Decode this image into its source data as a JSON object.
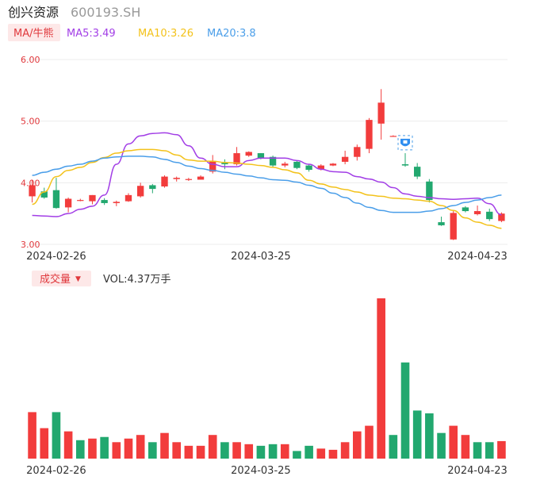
{
  "header": {
    "name": "创兴资源",
    "code": "600193.SH"
  },
  "indicator_button": {
    "label": "MA/牛熊",
    "color": "#e0383c",
    "bg": "#fde8e8"
  },
  "ma_legend": [
    {
      "label": "MA5:3.49",
      "color": "#a23ee6"
    },
    {
      "label": "MA10:3.26",
      "color": "#f3c21b"
    },
    {
      "label": "MA20:3.8",
      "color": "#4a9ee9"
    }
  ],
  "volume_button": {
    "label": "成交量",
    "arrow": "▼",
    "color": "#e0383c",
    "bg": "#fde8e8"
  },
  "volume_value": {
    "label": "VOL:4.37万手"
  },
  "colors": {
    "up": "#f23c3c",
    "down": "#22a86f",
    "grid": "#ececec",
    "axis_label": "#e0383c",
    "date_label": "#333333"
  },
  "chart_data": [
    {
      "type": "candlestick",
      "title": "",
      "ylim": [
        3.0,
        6.0
      ],
      "y_ticks": [
        "6.00",
        "5.00",
        "4.00",
        "3.00"
      ],
      "y_tick_values": [
        6.0,
        5.0,
        4.0,
        3.0
      ],
      "x_tick_labels": [
        {
          "label": "2024-02-26",
          "index": 2
        },
        {
          "label": "2024-03-25",
          "index": 19
        },
        {
          "label": "2024-04-23",
          "index": 37
        }
      ],
      "candles": [
        {
          "o": 3.78,
          "h": 4.05,
          "l": 3.68,
          "c": 3.96
        },
        {
          "o": 3.86,
          "h": 3.92,
          "l": 3.74,
          "c": 3.76
        },
        {
          "o": 3.88,
          "h": 4.08,
          "l": 3.58,
          "c": 3.59
        },
        {
          "o": 3.6,
          "h": 3.76,
          "l": 3.52,
          "c": 3.74
        },
        {
          "o": 3.71,
          "h": 3.74,
          "l": 3.7,
          "c": 3.72
        },
        {
          "o": 3.7,
          "h": 3.8,
          "l": 3.65,
          "c": 3.8
        },
        {
          "o": 3.72,
          "h": 3.75,
          "l": 3.64,
          "c": 3.67
        },
        {
          "o": 3.67,
          "h": 3.71,
          "l": 3.62,
          "c": 3.69
        },
        {
          "o": 3.7,
          "h": 3.83,
          "l": 3.69,
          "c": 3.8
        },
        {
          "o": 3.78,
          "h": 4.0,
          "l": 3.76,
          "c": 3.95
        },
        {
          "o": 3.96,
          "h": 3.98,
          "l": 3.83,
          "c": 3.9
        },
        {
          "o": 3.94,
          "h": 4.12,
          "l": 3.92,
          "c": 4.1
        },
        {
          "o": 4.06,
          "h": 4.1,
          "l": 4.02,
          "c": 4.08
        },
        {
          "o": 4.05,
          "h": 4.08,
          "l": 4.03,
          "c": 4.06
        },
        {
          "o": 4.05,
          "h": 4.12,
          "l": 4.05,
          "c": 4.1
        },
        {
          "o": 4.18,
          "h": 4.45,
          "l": 4.15,
          "c": 4.35
        },
        {
          "o": 4.32,
          "h": 4.38,
          "l": 4.22,
          "c": 4.3
        },
        {
          "o": 4.3,
          "h": 4.58,
          "l": 4.28,
          "c": 4.48
        },
        {
          "o": 4.44,
          "h": 4.51,
          "l": 4.42,
          "c": 4.5
        },
        {
          "o": 4.48,
          "h": 4.48,
          "l": 4.38,
          "c": 4.4
        },
        {
          "o": 4.42,
          "h": 4.44,
          "l": 4.25,
          "c": 4.28
        },
        {
          "o": 4.28,
          "h": 4.34,
          "l": 4.25,
          "c": 4.31
        },
        {
          "o": 4.34,
          "h": 4.36,
          "l": 4.22,
          "c": 4.24
        },
        {
          "o": 4.28,
          "h": 4.3,
          "l": 4.18,
          "c": 4.21
        },
        {
          "o": 4.22,
          "h": 4.3,
          "l": 4.2,
          "c": 4.28
        },
        {
          "o": 4.28,
          "h": 4.32,
          "l": 4.27,
          "c": 4.31
        },
        {
          "o": 4.34,
          "h": 4.52,
          "l": 4.3,
          "c": 4.42
        },
        {
          "o": 4.42,
          "h": 4.62,
          "l": 4.36,
          "c": 4.58
        },
        {
          "o": 4.55,
          "h": 5.05,
          "l": 4.48,
          "c": 5.02
        },
        {
          "o": 4.96,
          "h": 5.52,
          "l": 4.7,
          "c": 5.3
        },
        {
          "o": 4.76,
          "h": 4.77,
          "l": 4.75,
          "c": 4.76
        },
        {
          "o": 4.3,
          "h": 4.48,
          "l": 4.26,
          "c": 4.28
        },
        {
          "o": 4.26,
          "h": 4.32,
          "l": 4.06,
          "c": 4.1
        },
        {
          "o": 4.02,
          "h": 4.06,
          "l": 3.68,
          "c": 3.72
        },
        {
          "o": 3.36,
          "h": 3.45,
          "l": 3.3,
          "c": 3.31
        },
        {
          "o": 3.08,
          "h": 3.55,
          "l": 3.07,
          "c": 3.51
        },
        {
          "o": 3.6,
          "h": 3.62,
          "l": 3.52,
          "c": 3.54
        },
        {
          "o": 3.49,
          "h": 3.63,
          "l": 3.47,
          "c": 3.54
        },
        {
          "o": 3.53,
          "h": 3.58,
          "l": 3.38,
          "c": 3.41
        },
        {
          "o": 3.38,
          "h": 3.52,
          "l": 3.36,
          "c": 3.5
        }
      ],
      "ma_series": [
        {
          "name": "MA5",
          "color": "#a23ee6",
          "values": [
            3.47,
            3.46,
            3.45,
            3.5,
            3.57,
            3.62,
            3.8,
            4.3,
            4.63,
            4.76,
            4.8,
            4.81,
            4.78,
            4.6,
            4.4,
            4.3,
            4.26,
            4.26,
            4.36,
            4.4,
            4.4,
            4.4,
            4.36,
            4.3,
            4.22,
            4.18,
            4.17,
            4.1,
            4.06,
            4.01,
            3.92,
            3.82,
            3.78,
            3.76,
            3.74,
            3.73,
            3.74,
            3.75,
            3.66,
            3.48
          ]
        },
        {
          "name": "MA10",
          "color": "#f3c21b",
          "values": [
            3.65,
            3.85,
            4.1,
            4.2,
            4.25,
            4.33,
            4.41,
            4.48,
            4.52,
            4.54,
            4.54,
            4.52,
            4.45,
            4.37,
            4.35,
            4.35,
            4.33,
            4.32,
            4.3,
            4.28,
            4.25,
            4.21,
            4.16,
            4.04,
            3.98,
            3.93,
            3.89,
            3.85,
            3.8,
            3.78,
            3.75,
            3.74,
            3.72,
            3.7,
            3.63,
            3.55,
            3.43,
            3.36,
            3.31,
            3.26
          ]
        },
        {
          "name": "MA20",
          "color": "#4a9ee9",
          "values": [
            4.12,
            4.17,
            4.22,
            4.27,
            4.3,
            4.35,
            4.4,
            4.42,
            4.43,
            4.43,
            4.42,
            4.38,
            4.33,
            4.27,
            4.23,
            4.2,
            4.17,
            4.14,
            4.11,
            4.08,
            4.05,
            4.04,
            4.01,
            3.96,
            3.91,
            3.83,
            3.76,
            3.67,
            3.6,
            3.55,
            3.52,
            3.52,
            3.52,
            3.54,
            3.58,
            3.63,
            3.68,
            3.72,
            3.76,
            3.8
          ]
        }
      ],
      "marker": {
        "index": 31,
        "value": 4.65,
        "icon": "shield-badge-icon"
      }
    },
    {
      "type": "bar",
      "title": "",
      "series_name": "VOL",
      "volumes": [
        11.6,
        7.6,
        11.6,
        6.8,
        4.6,
        5.0,
        5.4,
        4.1,
        5.0,
        5.9,
        4.1,
        6.4,
        4.1,
        3.2,
        3.2,
        5.9,
        4.1,
        4.1,
        3.6,
        3.2,
        3.6,
        3.6,
        1.9,
        3.2,
        2.5,
        2.2,
        4.1,
        6.8,
        8.2,
        40.0,
        5.9,
        24.0,
        12.0,
        11.3,
        6.4,
        8.2,
        5.9,
        4.1,
        4.1,
        4.37
      ],
      "up": [
        true,
        true,
        false,
        true,
        false,
        true,
        false,
        true,
        true,
        true,
        false,
        true,
        true,
        true,
        true,
        true,
        false,
        true,
        true,
        false,
        false,
        true,
        false,
        false,
        true,
        true,
        true,
        true,
        true,
        true,
        false,
        false,
        false,
        false,
        false,
        true,
        true,
        false,
        false,
        true
      ]
    }
  ]
}
